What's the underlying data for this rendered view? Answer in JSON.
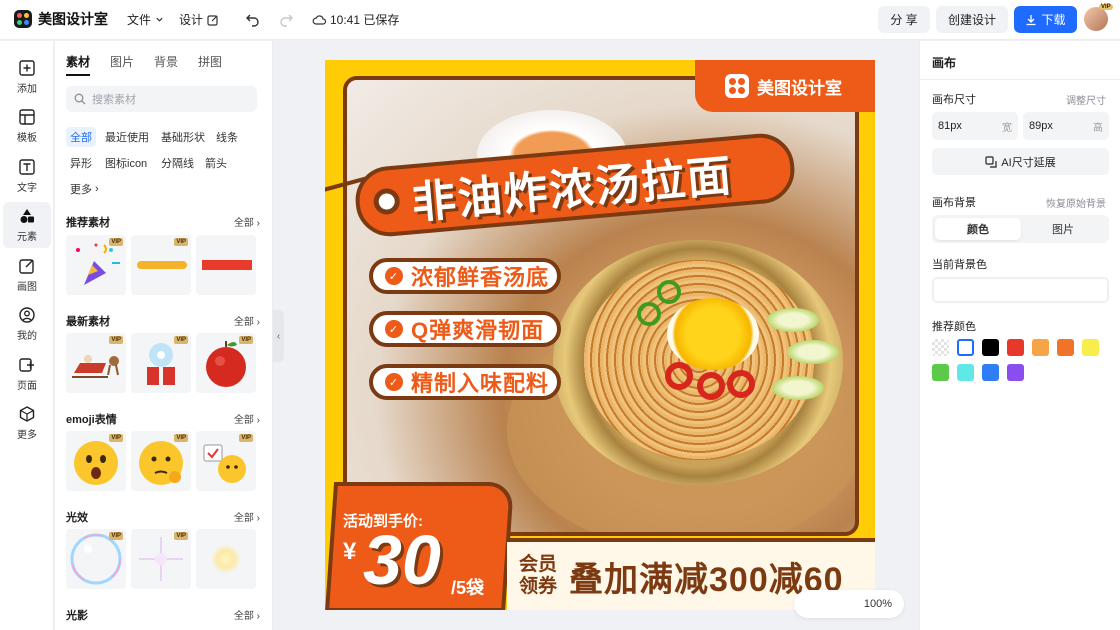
{
  "app": {
    "name": "美图设计室"
  },
  "topbar": {
    "file_label": "文件",
    "design_label": "设计",
    "save_status": "10:41 已保存",
    "share_label": "分 享",
    "create_label": "创建设计",
    "download_label": "下载",
    "vip_badge": "VIP"
  },
  "rail": [
    {
      "label": "添加",
      "icon": "plus-square-icon"
    },
    {
      "label": "模板",
      "icon": "template-icon"
    },
    {
      "label": "文字",
      "icon": "text-icon"
    },
    {
      "label": "元素",
      "icon": "shapes-icon"
    },
    {
      "label": "画图",
      "icon": "edit-icon"
    },
    {
      "label": "我的",
      "icon": "user-icon"
    },
    {
      "label": "页面",
      "icon": "page-add-icon"
    },
    {
      "label": "更多",
      "icon": "box-icon"
    }
  ],
  "panel": {
    "tabs": [
      "素材",
      "图片",
      "背景",
      "拼图"
    ],
    "search_placeholder": "搜索素材",
    "chips": [
      "全部",
      "最近使用",
      "基础形状",
      "线条",
      "异形",
      "图标icon",
      "分隔线",
      "箭头",
      "更多"
    ],
    "sections": [
      {
        "title": "推荐素材",
        "more": "全部"
      },
      {
        "title": "最新素材",
        "more": "全部"
      },
      {
        "title": "emoji表情",
        "more": "全部"
      },
      {
        "title": "光效",
        "more": "全部"
      },
      {
        "title": "光影",
        "more": "全部"
      }
    ],
    "vip": "VIP"
  },
  "poster": {
    "brand": "美图设计室",
    "headline": "非油炸浓汤拉面",
    "features": [
      "浓郁鲜香汤底",
      "Q弹爽滑韧面",
      "精制入味配料"
    ],
    "price_label": "活动到手价:",
    "currency": "¥",
    "price": "30",
    "unit": "/5袋",
    "member_tag_1": "会员",
    "member_tag_2": "领券",
    "promo": "叠加满减300减60"
  },
  "zoom": {
    "value": "100%"
  },
  "right_panel": {
    "title": "画布",
    "size_label": "画布尺寸",
    "resize_link": "调整尺寸",
    "width_value": "81px",
    "width_unit": "宽",
    "height_value": "89px",
    "height_unit": "高",
    "ai_button": "AI尺寸延展",
    "bg_label": "画布背景",
    "restore_link": "恢复原始背景",
    "seg_color": "颜色",
    "seg_image": "图片",
    "current_bg_label": "当前背景色",
    "recommended_label": "推荐颜色",
    "swatches": [
      "transparent",
      "#ffffff",
      "#000000",
      "#e8382b",
      "#f5a448",
      "#f0732a",
      "#f7ee4a",
      "#5cc94a",
      "#5fe8e6",
      "#2f7ef5",
      "#8a4df0"
    ]
  }
}
